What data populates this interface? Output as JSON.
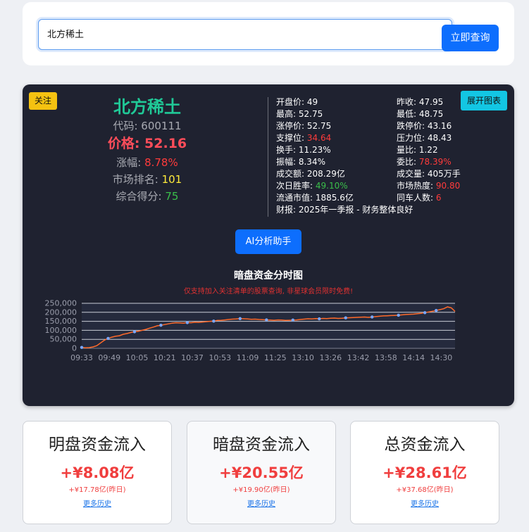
{
  "search": {
    "value": "北方稀土",
    "button_label": "立即查询"
  },
  "card": {
    "follow_label": "关注",
    "expand_label": "展开图表",
    "name": "北方稀土",
    "code_label": "代码: ",
    "code": "600111",
    "price_label": "价格: ",
    "price": "52.16",
    "change_label": "涨幅: ",
    "change": "8.78%",
    "rank_label": "市场排名: ",
    "rank": "101",
    "score_label": "综合得分: ",
    "score": "75",
    "metrics": [
      {
        "label": "开盘价: ",
        "value": "49",
        "color": "#ffffff"
      },
      {
        "label": "昨收: ",
        "value": "47.95",
        "color": "#ffffff"
      },
      {
        "label": "最高: ",
        "value": "52.75",
        "color": "#ffffff"
      },
      {
        "label": "最低: ",
        "value": "48.75",
        "color": "#ffffff"
      },
      {
        "label": "涨停价: ",
        "value": "52.75",
        "color": "#ffffff"
      },
      {
        "label": "跌停价: ",
        "value": "43.16",
        "color": "#ffffff"
      },
      {
        "label": "支撑位: ",
        "value": "34.64",
        "color": "#ff3b3b"
      },
      {
        "label": "压力位: ",
        "value": "48.43",
        "color": "#ffffff"
      },
      {
        "label": "换手: ",
        "value": "11.23%",
        "color": "#ffffff"
      },
      {
        "label": "量比: ",
        "value": "1.22",
        "color": "#ffffff"
      },
      {
        "label": "振幅: ",
        "value": "8.34%",
        "color": "#ffffff"
      },
      {
        "label": "委比: ",
        "value": "78.39%",
        "color": "#ff3b3b"
      },
      {
        "label": "成交额: ",
        "value": "208.29亿",
        "color": "#ffffff"
      },
      {
        "label": "成交量: ",
        "value": "405万手",
        "color": "#ffffff"
      },
      {
        "label": "次日胜率: ",
        "value": "49.10%",
        "color": "#3abf4a"
      },
      {
        "label": "市场热度: ",
        "value": "90.80",
        "color": "#ff3b3b"
      },
      {
        "label": "流通市值: ",
        "value": "1885.6亿",
        "color": "#ffffff"
      },
      {
        "label": "同车人数: ",
        "value": "6",
        "color": "#ff3b3b"
      },
      {
        "label": "财报: ",
        "value": "2025年一季报 - 财务整体良好",
        "color": "#ffffff"
      }
    ],
    "ai_label": "AI分析助手"
  },
  "chart_data": {
    "type": "line",
    "title": "暗盘资金分时图",
    "subtitle": "仅支持加入关注清单的股票查询, 非星球会员限时免费!",
    "x_ticks": [
      "09:33",
      "09:49",
      "10:05",
      "10:21",
      "10:37",
      "10:53",
      "11:09",
      "11:25",
      "13:10",
      "13:26",
      "13:42",
      "13:58",
      "14:14",
      "14:30"
    ],
    "y_ticks": [
      0,
      50000,
      100000,
      150000,
      200000,
      250000
    ],
    "y_tick_labels": [
      "0",
      "50,000",
      "100,000",
      "150,000",
      "200,000",
      "250,000"
    ],
    "ylim": [
      0,
      250000
    ],
    "grid": true,
    "line_color": "#ff6a2a",
    "marker_color": "#7aa7ff",
    "series": [
      {
        "values": [
          5000,
          3000,
          4000,
          8000,
          15000,
          30000,
          45000,
          55000,
          62000,
          67000,
          70000,
          78000,
          82000,
          88000,
          92000,
          95000,
          100000,
          105000,
          112000,
          118000,
          125000,
          128000,
          132000,
          136000,
          140000,
          142000,
          141000,
          140000,
          143000,
          142000,
          145000,
          144000,
          146000,
          148000,
          150000,
          151000,
          155000,
          156000,
          158000,
          160000,
          162000,
          163000,
          165000,
          164000,
          163000,
          161000,
          162000,
          160000,
          159000,
          158000,
          157000,
          156000,
          158000,
          157000,
          155000,
          156000,
          157000,
          158000,
          160000,
          162000,
          164000,
          163000,
          165000,
          164000,
          166000,
          165000,
          167000,
          168000,
          166000,
          167000,
          169000,
          170000,
          171000,
          172000,
          173000,
          174000,
          172000,
          174000,
          176000,
          178000,
          180000,
          181000,
          182000,
          183000,
          184000,
          186000,
          188000,
          189000,
          190000,
          192000,
          194000,
          198000,
          202000,
          206000,
          210000,
          215000,
          220000,
          230000,
          225000,
          205000
        ],
        "marker_indices": [
          0,
          7,
          14,
          21,
          28,
          35,
          42,
          49,
          56,
          63,
          70,
          77,
          84,
          91,
          94
        ]
      }
    ]
  },
  "flows": [
    {
      "title": "明盘资金流入",
      "value": "+¥8.08亿",
      "prev": "+¥17.78亿(昨日)",
      "link": "更多历史"
    },
    {
      "title": "暗盘资金流入",
      "value": "+¥20.55亿",
      "prev": "+¥19.90亿(昨日)",
      "link": "更多历史"
    },
    {
      "title": "总资金流入",
      "value": "+¥28.61亿",
      "prev": "+¥37.68亿(昨日)",
      "link": "更多历史"
    }
  ]
}
